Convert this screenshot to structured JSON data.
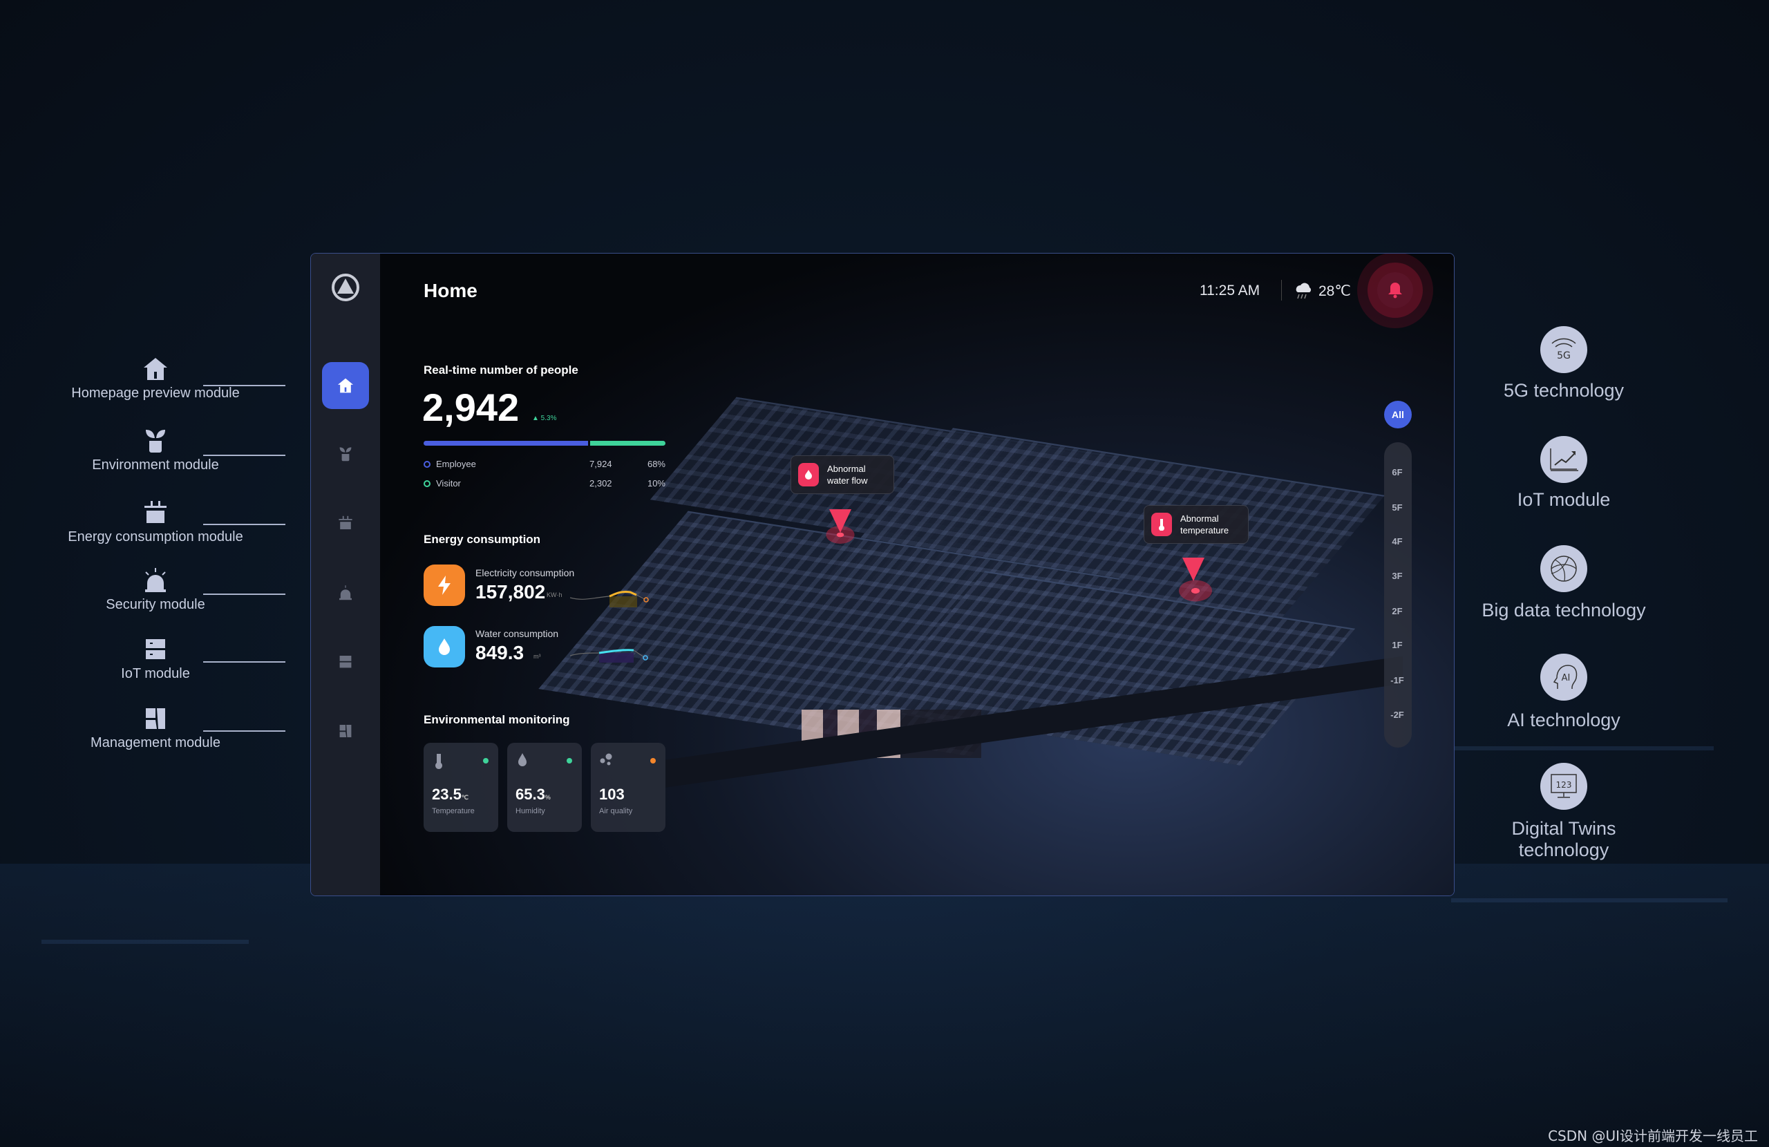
{
  "modules": [
    {
      "label": "Homepage preview module",
      "icon": "home-icon"
    },
    {
      "label": "Environment module",
      "icon": "plant-icon"
    },
    {
      "label": "Energy consumption module",
      "icon": "plug-icon"
    },
    {
      "label": "Security module",
      "icon": "alarm-icon"
    },
    {
      "label": "IoT module",
      "icon": "server-icon"
    },
    {
      "label": "Management module",
      "icon": "layout-icon"
    }
  ],
  "technologies": [
    {
      "label": "5G technology",
      "icon": "5g-icon",
      "glyph": "5G"
    },
    {
      "label": "IoT module",
      "icon": "chart-icon"
    },
    {
      "label": "Big data technology",
      "icon": "globe-icon"
    },
    {
      "label": "AI technology",
      "icon": "ai-head-icon",
      "glyph": "AI"
    },
    {
      "label": "Digital Twins technology",
      "icon": "monitor-icon",
      "glyph": "123"
    }
  ],
  "header": {
    "title": "Home",
    "time": "11:25 AM",
    "weather_icon": "cloud-rain-icon",
    "temperature": "28℃",
    "alert_color": "#f0355f"
  },
  "people": {
    "title": "Real-time number of people",
    "total": "2,942",
    "change": "▲ 5.3%",
    "employee_share": 0.68,
    "visitor_share": 0.32,
    "rows": [
      {
        "label": "Employee",
        "count": "7,924",
        "percent": "68%",
        "color": "#4a5ee0"
      },
      {
        "label": "Visitor",
        "count": "2,302",
        "percent": "10%",
        "color": "#3fd39a"
      }
    ]
  },
  "energy": {
    "title": "Energy consumption",
    "electricity": {
      "label": "Electricity consumption",
      "value": "157,802",
      "unit": "KW·h",
      "color": "#f5862b"
    },
    "water": {
      "label": "Water consumption",
      "value": "849.3",
      "unit": "m³",
      "color": "#46b8f5"
    }
  },
  "environment": {
    "title": "Environmental monitoring",
    "cards": [
      {
        "value": "23.5",
        "unit": "℃",
        "label": "Temperature",
        "status_color": "#3fd39a",
        "icon": "thermometer-icon"
      },
      {
        "value": "65.3",
        "unit": "%",
        "label": "Humidity",
        "status_color": "#3fd39a",
        "icon": "droplet-icon"
      },
      {
        "value": "103",
        "unit": "",
        "label": "Air quality",
        "status_color": "#f5862b",
        "icon": "particles-icon"
      }
    ]
  },
  "floors": {
    "all": "All",
    "list": [
      "6F",
      "5F",
      "4F",
      "3F",
      "2F",
      "1F",
      "-1F",
      "-2F"
    ]
  },
  "alerts": [
    {
      "line1": "Abnormal",
      "line2": "water flow",
      "icon": "droplet-icon"
    },
    {
      "line1": "Abnormal",
      "line2": "temperature",
      "icon": "thermometer-icon"
    }
  ],
  "watermark": "CSDN @UI设计前端开发一线员工"
}
